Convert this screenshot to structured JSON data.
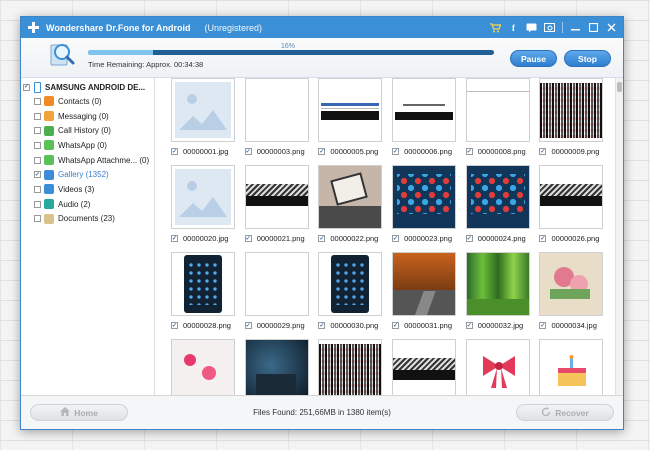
{
  "window": {
    "app_title": "Wondershare Dr.Fone for Android",
    "registration": "(Unregistered)"
  },
  "titlebar_icons": [
    "cart-icon",
    "facebook-icon",
    "chat-icon",
    "feedback-icon",
    "minimize-icon",
    "maximize-icon",
    "close-icon"
  ],
  "scan": {
    "progress_percent": 16,
    "progress_text": "16%",
    "time_remaining": "Time Remaining: Approx. 00:34:38",
    "pause_label": "Pause",
    "stop_label": "Stop"
  },
  "sidebar": {
    "device": "SAMSUNG ANDROID DE...",
    "items": [
      {
        "label": "Contacts (0)",
        "icon": "contacts-icon",
        "color": "#f08a24"
      },
      {
        "label": "Messaging (0)",
        "icon": "messaging-icon",
        "color": "#f2a33a"
      },
      {
        "label": "Call History (0)",
        "icon": "call-history-icon",
        "color": "#4cae4c"
      },
      {
        "label": "WhatsApp (0)",
        "icon": "whatsapp-icon",
        "color": "#58c157"
      },
      {
        "label": "WhatsApp Attachme... (0)",
        "icon": "whatsapp-attachments-icon",
        "color": "#58c157"
      },
      {
        "label": "Gallery (1352)",
        "icon": "gallery-icon",
        "color": "#3b8dd8"
      },
      {
        "label": "Videos (3)",
        "icon": "videos-icon",
        "color": "#3b8dd8"
      },
      {
        "label": "Audio (2)",
        "icon": "audio-icon",
        "color": "#28a9a0"
      },
      {
        "label": "Documents (23)",
        "icon": "documents-icon",
        "color": "#d8c48a"
      }
    ]
  },
  "gallery": {
    "files": [
      {
        "name": "00000001.jpg",
        "kind": "placeholder"
      },
      {
        "name": "00000003.png",
        "kind": "blank"
      },
      {
        "name": "00000005.png",
        "kind": "web-banner"
      },
      {
        "name": "00000006.png",
        "kind": "web-text"
      },
      {
        "name": "00000008.png",
        "kind": "blank-line"
      },
      {
        "name": "00000009.png",
        "kind": "noise"
      },
      {
        "name": "00000020.jpg",
        "kind": "placeholder"
      },
      {
        "name": "00000021.png",
        "kind": "stripes"
      },
      {
        "name": "00000022.png",
        "kind": "phone-hand"
      },
      {
        "name": "00000023.png",
        "kind": "app-grid"
      },
      {
        "name": "00000024.png",
        "kind": "app-grid"
      },
      {
        "name": "00000026.png",
        "kind": "stripes"
      },
      {
        "name": "00000028.png",
        "kind": "phone-screen"
      },
      {
        "name": "00000029.png",
        "kind": "blank"
      },
      {
        "name": "00000030.png",
        "kind": "phone-screen"
      },
      {
        "name": "00000031.png",
        "kind": "autumn-road"
      },
      {
        "name": "00000032.jpg",
        "kind": "forest"
      },
      {
        "name": "00000034.jpg",
        "kind": "roses"
      },
      {
        "name": "",
        "kind": "flowers"
      },
      {
        "name": "",
        "kind": "night-city"
      },
      {
        "name": "",
        "kind": "noise"
      },
      {
        "name": "",
        "kind": "stripes"
      },
      {
        "name": "",
        "kind": "ribbon"
      },
      {
        "name": "",
        "kind": "cake"
      }
    ]
  },
  "footer": {
    "home_label": "Home",
    "recover_label": "Recover",
    "files_found": "Files Found: 251,66MB in 1380 item(s)"
  }
}
